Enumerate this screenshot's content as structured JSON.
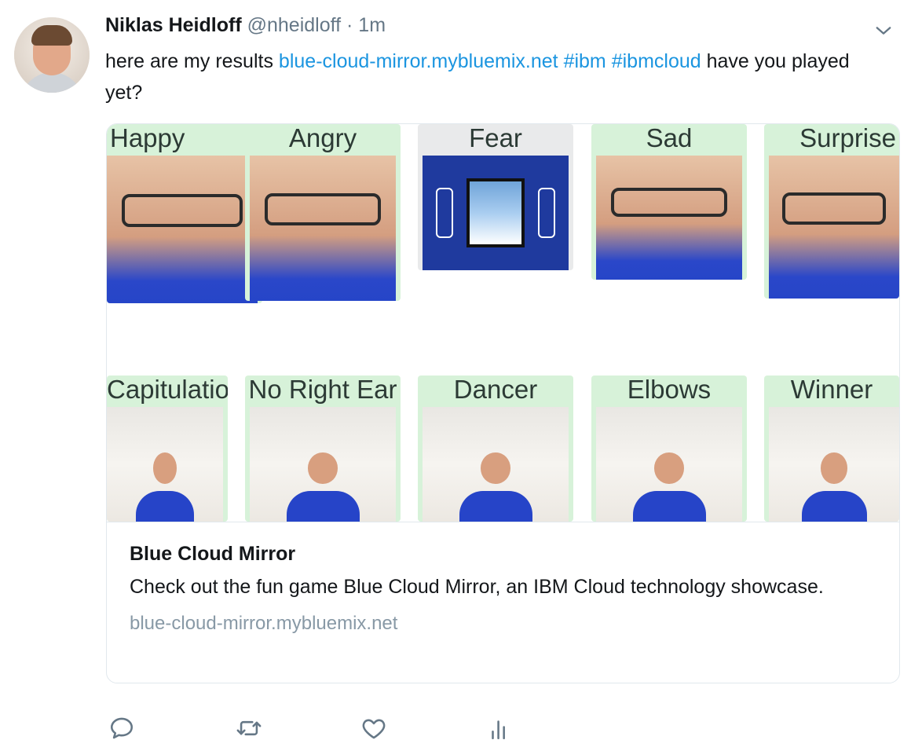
{
  "tweet": {
    "author_name": "Niklas Heidloff",
    "author_handle": "@nheidloff",
    "separator": "·",
    "time": "1m",
    "text_prefix": "here are my results",
    "link_url": "blue-cloud-mirror.mybluemix.net",
    "hashtag_1": "#ibm",
    "hashtag_2": "#ibmcloud",
    "text_suffix": "have you played yet?"
  },
  "card": {
    "image_labels": {
      "row1": [
        "Happy",
        "Angry",
        "Fear",
        "Sad",
        "Surprise"
      ],
      "row2": [
        "Capitulation",
        "No Right Ear",
        "Dancer",
        "Elbows",
        "Winner"
      ]
    },
    "title": "Blue Cloud Mirror",
    "description": "Check out the fun game Blue Cloud Mirror, an IBM Cloud technology showcase.",
    "url": "blue-cloud-mirror.mybluemix.net"
  },
  "icons": {
    "reply": "reply-icon",
    "retweet": "retweet-icon",
    "like": "heart-icon",
    "analytics": "analytics-icon",
    "menu": "chevron-down-icon"
  },
  "colors": {
    "link": "#1b95e0",
    "muted": "#657786",
    "tile_label_bg": "#d7f2d9"
  }
}
